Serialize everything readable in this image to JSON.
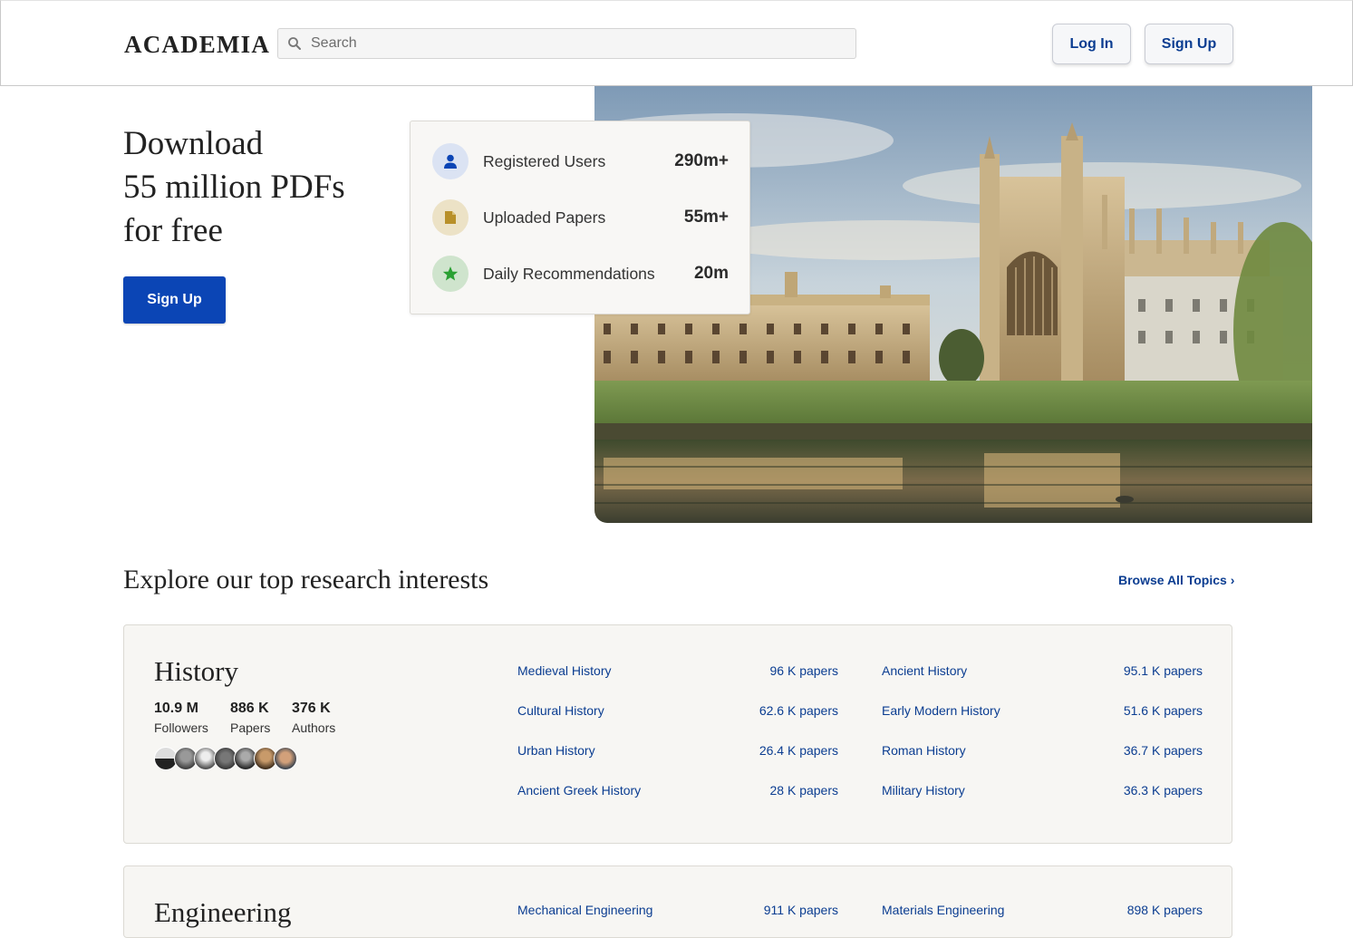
{
  "header": {
    "logo": "ACADEMIA",
    "search_placeholder": "Search",
    "login_label": "Log In",
    "signup_label": "Sign Up"
  },
  "hero": {
    "title_lines": [
      "Download",
      "55 million PDFs",
      "for free"
    ],
    "signup_label": "Sign Up",
    "stats": [
      {
        "label": "Registered Users",
        "value": "290m+",
        "icon": "person-icon",
        "circle_color": "#dbe3f3",
        "icon_color": "#0b45b5"
      },
      {
        "label": "Uploaded Papers",
        "value": "55m+",
        "icon": "document-icon",
        "circle_color": "#ece2c6",
        "icon_color": "#b8902a"
      },
      {
        "label": "Daily Recommendations",
        "value": "20m",
        "icon": "star-icon",
        "circle_color": "#cfe4cd",
        "icon_color": "#2aa033"
      }
    ]
  },
  "explore": {
    "title": "Explore our top research interests",
    "browse_label": "Browse All Topics ›"
  },
  "cards": [
    {
      "title": "History",
      "metrics": [
        {
          "value": "10.9 M",
          "label": "Followers"
        },
        {
          "value": "886 K",
          "label": "Papers"
        },
        {
          "value": "376 K",
          "label": "Authors"
        }
      ],
      "topics_left": [
        {
          "name": "Medieval History",
          "count": "96 K papers"
        },
        {
          "name": "Cultural History",
          "count": "62.6 K papers"
        },
        {
          "name": "Urban History",
          "count": "26.4 K papers"
        },
        {
          "name": "Ancient Greek History",
          "count": "28 K papers"
        }
      ],
      "topics_right": [
        {
          "name": "Ancient History",
          "count": "95.1 K papers"
        },
        {
          "name": "Early Modern History",
          "count": "51.6 K papers"
        },
        {
          "name": "Roman History",
          "count": "36.7 K papers"
        },
        {
          "name": "Military History",
          "count": "36.3 K papers"
        }
      ]
    },
    {
      "title": "Engineering",
      "topics_left": [
        {
          "name": "Mechanical Engineering",
          "count": "911 K papers"
        }
      ],
      "topics_right": [
        {
          "name": "Materials Engineering",
          "count": "898 K papers"
        }
      ]
    }
  ],
  "colors": {
    "brand_blue": "#0b45b5",
    "link_blue": "#0b3d91",
    "card_bg": "#f7f6f3"
  }
}
